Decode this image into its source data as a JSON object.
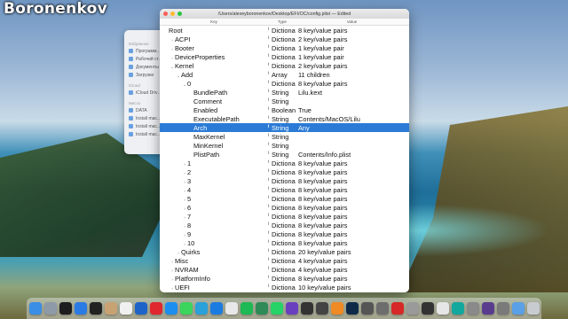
{
  "watermark": "Boronenkov",
  "window": {
    "title": "/Users/alexeyboronenkov/Desktop/EFI/OC/config.plist — Edited",
    "columns": [
      "Key",
      "Type",
      "Value"
    ]
  },
  "finder_sidebar": [
    {
      "section": "Избранное",
      "items": [
        "Программ…",
        "Рабочий ст…",
        "Документы",
        "Загрузки"
      ]
    },
    {
      "section": "iCloud",
      "items": [
        "iCloud Driv…"
      ]
    },
    {
      "section": "Места",
      "items": [
        "DATA",
        "Install mac…",
        "Install mac…",
        "Install mac…"
      ]
    }
  ],
  "rows": [
    {
      "key": "Root",
      "indent": 0,
      "tri": "",
      "type": "Dictiona",
      "value": "8 key/value pairs"
    },
    {
      "key": "ACPI",
      "indent": 1,
      "tri": "›",
      "type": "Dictiona",
      "value": "2 key/value pairs"
    },
    {
      "key": "Booter",
      "indent": 1,
      "tri": "›",
      "type": "Dictiona",
      "value": "1 key/value pair"
    },
    {
      "key": "DeviceProperties",
      "indent": 1,
      "tri": "›",
      "type": "Dictiona",
      "value": "1 key/value pair"
    },
    {
      "key": "Kernel",
      "indent": 1,
      "tri": "⌄",
      "type": "Dictiona",
      "value": "2 key/value pairs"
    },
    {
      "key": "Add",
      "indent": 2,
      "tri": "⌄",
      "type": "Array",
      "value": "11 children"
    },
    {
      "key": "0",
      "indent": 3,
      "tri": "⌄",
      "type": "Dictiona",
      "value": "8 key/value pairs"
    },
    {
      "key": "BundlePath",
      "indent": 4,
      "tri": "",
      "type": "String",
      "value": "Lilu.kext"
    },
    {
      "key": "Comment",
      "indent": 4,
      "tri": "",
      "type": "String",
      "value": ""
    },
    {
      "key": "Enabled",
      "indent": 4,
      "tri": "",
      "type": "Boolean",
      "value": "True"
    },
    {
      "key": "ExecutablePath",
      "indent": 4,
      "tri": "",
      "type": "String",
      "value": "Contents/MacOS/Lilu"
    },
    {
      "key": "Arch",
      "indent": 4,
      "tri": "",
      "type": "String",
      "value": "Any",
      "selected": true
    },
    {
      "key": "MaxKernel",
      "indent": 4,
      "tri": "",
      "type": "String",
      "value": ""
    },
    {
      "key": "MinKernel",
      "indent": 4,
      "tri": "",
      "type": "String",
      "value": ""
    },
    {
      "key": "PlistPath",
      "indent": 4,
      "tri": "",
      "type": "String",
      "value": "Contents/Info.plist"
    },
    {
      "key": "1",
      "indent": 3,
      "tri": "›",
      "type": "Dictiona",
      "value": "8 key/value pairs"
    },
    {
      "key": "2",
      "indent": 3,
      "tri": "›",
      "type": "Dictiona",
      "value": "8 key/value pairs"
    },
    {
      "key": "3",
      "indent": 3,
      "tri": "›",
      "type": "Dictiona",
      "value": "8 key/value pairs"
    },
    {
      "key": "4",
      "indent": 3,
      "tri": "›",
      "type": "Dictiona",
      "value": "8 key/value pairs"
    },
    {
      "key": "5",
      "indent": 3,
      "tri": "›",
      "type": "Dictiona",
      "value": "8 key/value pairs"
    },
    {
      "key": "6",
      "indent": 3,
      "tri": "›",
      "type": "Dictiona",
      "value": "8 key/value pairs"
    },
    {
      "key": "7",
      "indent": 3,
      "tri": "›",
      "type": "Dictiona",
      "value": "8 key/value pairs"
    },
    {
      "key": "8",
      "indent": 3,
      "tri": "›",
      "type": "Dictiona",
      "value": "8 key/value pairs"
    },
    {
      "key": "9",
      "indent": 3,
      "tri": "›",
      "type": "Dictiona",
      "value": "8 key/value pairs"
    },
    {
      "key": "10",
      "indent": 3,
      "tri": "›",
      "type": "Dictiona",
      "value": "8 key/value pairs"
    },
    {
      "key": "Quirks",
      "indent": 2,
      "tri": "›",
      "type": "Dictiona",
      "value": "20 key/value pairs"
    },
    {
      "key": "Misc",
      "indent": 1,
      "tri": "›",
      "type": "Dictiona",
      "value": "4 key/value pairs"
    },
    {
      "key": "NVRAM",
      "indent": 1,
      "tri": "›",
      "type": "Dictiona",
      "value": "4 key/value pairs"
    },
    {
      "key": "PlatformInfo",
      "indent": 1,
      "tri": "›",
      "type": "Dictiona",
      "value": "8 key/value pairs"
    },
    {
      "key": "UEFI",
      "indent": 1,
      "tri": "›",
      "type": "Dictiona",
      "value": "10 key/value pairs"
    }
  ],
  "colors": {
    "selection": "#2b7bd6",
    "close": "#fc5f57",
    "minimize": "#fdbc2e",
    "zoom": "#28c840"
  },
  "dock": [
    {
      "name": "finder-icon",
      "color": "#3a8ee6"
    },
    {
      "name": "launchpad-icon",
      "color": "#8e9aa8"
    },
    {
      "name": "stocks-icon",
      "color": "#1d1d1f"
    },
    {
      "name": "mail-icon",
      "color": "#2c7be5"
    },
    {
      "name": "terminal-icon",
      "color": "#222"
    },
    {
      "name": "contacts-icon",
      "color": "#c9a273"
    },
    {
      "name": "yandex-browser-icon",
      "color": "#f0f0f0"
    },
    {
      "name": "blue-app-icon",
      "color": "#1e63c8"
    },
    {
      "name": "opera-icon",
      "color": "#e0262f"
    },
    {
      "name": "app-store-icon",
      "color": "#1c8ef0"
    },
    {
      "name": "messages-icon",
      "color": "#3bd45d"
    },
    {
      "name": "telegram-icon",
      "color": "#2aa1da"
    },
    {
      "name": "imo-icon",
      "color": "#1c7be0"
    },
    {
      "name": "itunes-icon",
      "color": "#e8e8e8"
    },
    {
      "name": "spotify-icon",
      "color": "#1db954"
    },
    {
      "name": "green-app-icon",
      "color": "#2e8b57"
    },
    {
      "name": "whatsapp-icon",
      "color": "#25d366"
    },
    {
      "name": "purple-app-icon",
      "color": "#6a3fbf"
    },
    {
      "name": "final-cut-icon",
      "color": "#333"
    },
    {
      "name": "fcp-icon",
      "color": "#444"
    },
    {
      "name": "orange-app-icon",
      "color": "#f08a24"
    },
    {
      "name": "photoshop-icon",
      "color": "#0f2a49"
    },
    {
      "name": "media-icon",
      "color": "#555"
    },
    {
      "name": "tools-icon",
      "color": "#6d6d6d"
    },
    {
      "name": "red-app-icon",
      "color": "#d62828"
    },
    {
      "name": "disk-icon",
      "color": "#9a9a9a"
    },
    {
      "name": "dark-app-icon",
      "color": "#333"
    },
    {
      "name": "plist-editor-icon",
      "color": "#e6e6e6"
    },
    {
      "name": "teal-app-icon",
      "color": "#13a89e"
    },
    {
      "name": "gray-app-icon",
      "color": "#8a8a8a"
    },
    {
      "name": "purple-wheel-icon",
      "color": "#5a3c8f"
    },
    {
      "name": "preferences-icon",
      "color": "#7a7a7a"
    },
    {
      "name": "downloads-icon",
      "color": "#5aa0e6"
    },
    {
      "name": "trash-icon",
      "color": "#c8ccd0"
    }
  ]
}
